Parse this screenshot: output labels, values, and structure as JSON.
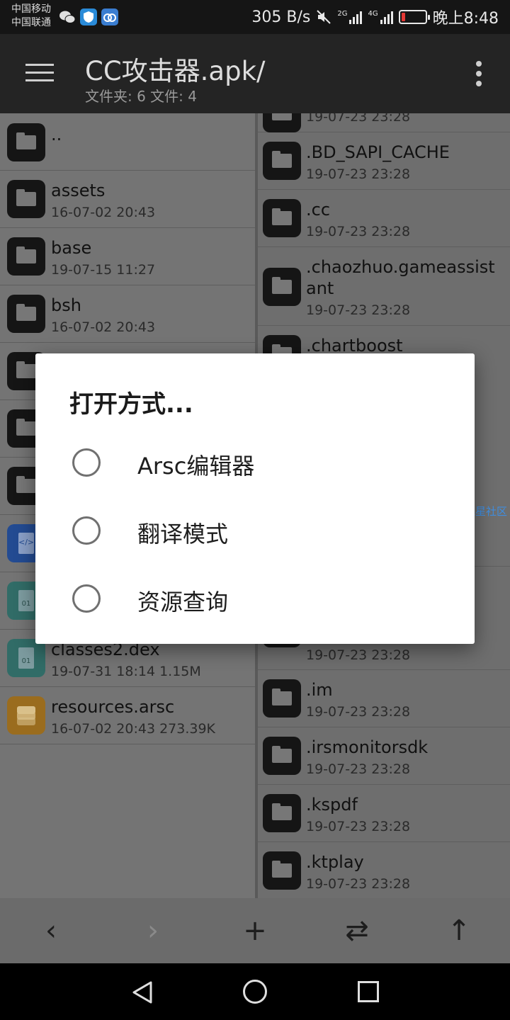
{
  "status_bar": {
    "carrier1": "中国移动",
    "carrier2": "中国联通",
    "speed": "305 B/s",
    "sig1_label": "2G",
    "sig2_label": "4G",
    "time": "晚上8:48",
    "icons": [
      "wechat-icon",
      "shield-icon",
      "app-icon",
      "mute-icon",
      "battery-low-icon"
    ],
    "battery_color": "#e53935"
  },
  "app_bar": {
    "title": "CC攻击器.apk/",
    "subtitle": "文件夹: 6  文件: 4"
  },
  "left_pane": {
    "items": [
      {
        "name": "..",
        "meta": ""
      },
      {
        "name": "assets",
        "meta": "16-07-02 20:43"
      },
      {
        "name": "base",
        "meta": "19-07-15 11:27"
      },
      {
        "name": "bsh",
        "meta": "16-07-02 20:43"
      },
      {
        "name": "",
        "meta": ""
      },
      {
        "name": "",
        "meta": ""
      },
      {
        "name": "",
        "meta": ""
      },
      {
        "name": "",
        "meta": ""
      },
      {
        "name": "",
        "meta": ""
      },
      {
        "name": "classes2.dex",
        "meta": "19-07-31 18:14  1.15M"
      },
      {
        "name": "resources.arsc",
        "meta": "16-07-02 20:43  273.39K"
      }
    ],
    "icon_labels": {
      "xml": "</>",
      "dex": "01"
    }
  },
  "right_pane": {
    "items": [
      {
        "name": "",
        "meta": "19-07-23 23:28"
      },
      {
        "name": ".BD_SAPI_CACHE",
        "meta": "19-07-23 23:28"
      },
      {
        "name": ".cc",
        "meta": "19-07-23 23:28"
      },
      {
        "name": ".chaozhuo.gameassist",
        "name2": "ant",
        "meta": "19-07-23 23:28"
      },
      {
        "name": ".chartboost",
        "meta": ""
      },
      {
        "name": "",
        "meta": "19-07-23 23:28"
      },
      {
        "name": ".im",
        "meta": "19-07-23 23:28"
      },
      {
        "name": ".irsmonitorsdk",
        "meta": "19-07-23 23:28"
      },
      {
        "name": ".kspdf",
        "meta": "19-07-23 23:28"
      },
      {
        "name": ".ktplay",
        "meta": "19-07-23 23:28"
      }
    ]
  },
  "toolbar": {
    "back": "‹",
    "forward": "›",
    "add": "+",
    "swap": "⇄",
    "up": "↑"
  },
  "dialog": {
    "title": "打开方式...",
    "options": [
      {
        "label": "Arsc编辑器",
        "selected": false
      },
      {
        "label": "翻译模式",
        "selected": false
      },
      {
        "label": "资源查询",
        "selected": false
      }
    ]
  },
  "watermark": "流星社区"
}
